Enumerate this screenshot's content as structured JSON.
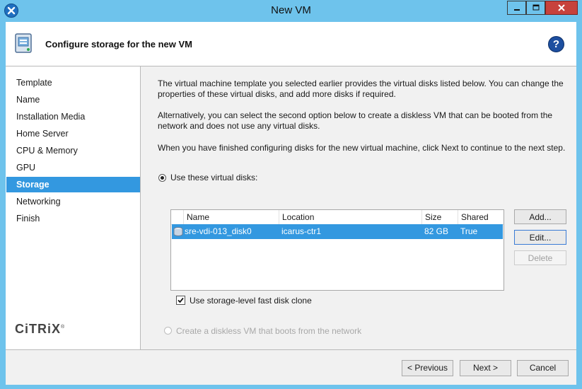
{
  "window": {
    "title": "New VM"
  },
  "header": {
    "title": "Configure storage for the new VM",
    "help_glyph": "?"
  },
  "sidebar": {
    "items": [
      {
        "label": "Template"
      },
      {
        "label": "Name"
      },
      {
        "label": "Installation Media"
      },
      {
        "label": "Home Server"
      },
      {
        "label": "CPU & Memory"
      },
      {
        "label": "GPU"
      },
      {
        "label": "Storage",
        "selected": true
      },
      {
        "label": "Networking"
      },
      {
        "label": "Finish"
      }
    ],
    "logo": {
      "text": "CiTRiX",
      "mark": "®"
    }
  },
  "main": {
    "paragraphs": [
      "The virtual machine template you selected earlier provides the virtual disks listed below. You can change the properties of these virtual disks, and add more disks if required.",
      "Alternatively, you can select the second option below to create a diskless VM that can be booted from the network and does not use any virtual disks.",
      "When you have finished configuring disks for the new virtual machine, click Next to continue to the next step."
    ],
    "option_disks": {
      "label": "Use these virtual disks:",
      "checked": true
    },
    "table": {
      "columns": [
        "Name",
        "Location",
        "Size",
        "Shared"
      ],
      "rows": [
        {
          "name": "sre-vdi-013_disk0",
          "location": "icarus-ctr1",
          "size": "82 GB",
          "shared": "True",
          "icon": "disk-icon"
        }
      ]
    },
    "buttons": {
      "add": "Add...",
      "edit": "Edit...",
      "delete": "Delete"
    },
    "fast_clone": {
      "label": "Use storage-level fast disk clone",
      "checked": true
    },
    "option_diskless": {
      "label": "Create a diskless VM that boots from the network",
      "checked": false,
      "disabled": true
    }
  },
  "footer": {
    "previous": "< Previous",
    "next": "Next >",
    "cancel": "Cancel"
  },
  "colors": {
    "titlebar": "#6ec3ec",
    "selection": "#3398e0",
    "close": "#c7423c"
  }
}
